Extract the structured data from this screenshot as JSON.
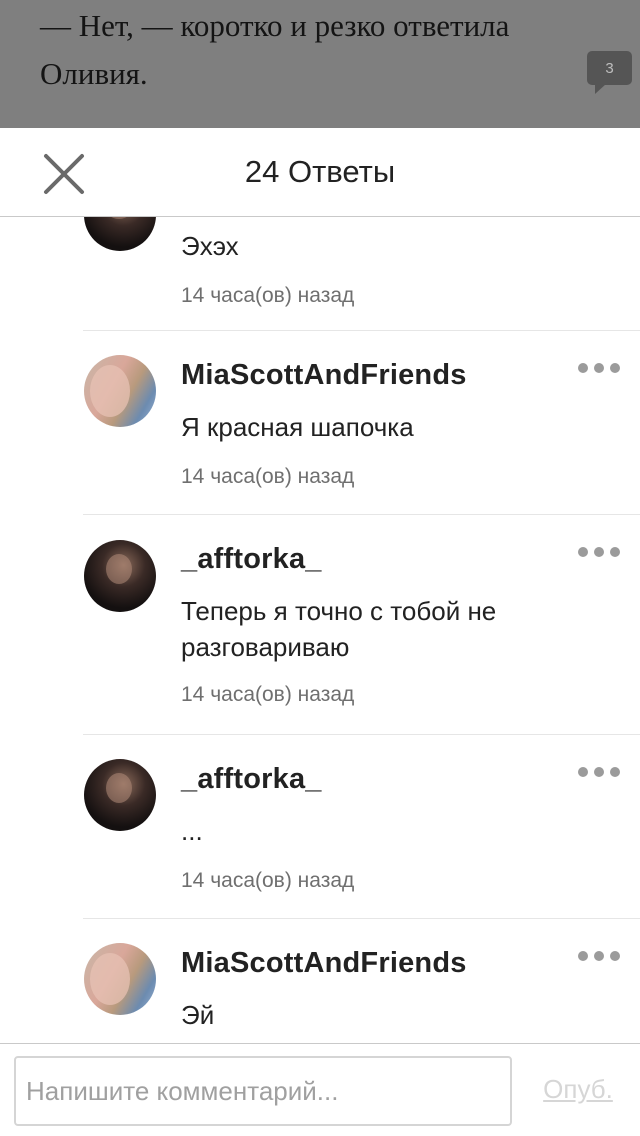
{
  "story": {
    "text": "— Нет, — коротко и резко ответила\nОливия.",
    "comment_count": "3"
  },
  "header": {
    "title": "24 Ответы",
    "close_icon": "close-icon"
  },
  "replies": [
    {
      "author": "",
      "avatar": "dark",
      "text": "Эхэх",
      "time": "14 часа(ов) назад"
    },
    {
      "author": "MiaScottAndFriends",
      "avatar": "light",
      "text": "Я красная шапочка",
      "time": "14 часа(ов) назад"
    },
    {
      "author": "_afftorka_",
      "avatar": "dark",
      "text": "Теперь я точно с тобой не разговариваю",
      "time": "14 часа(ов) назад"
    },
    {
      "author": "_afftorka_",
      "avatar": "dark",
      "text": "...",
      "time": "14 часа(ов) назад"
    },
    {
      "author": "MiaScottAndFriends",
      "avatar": "light",
      "text": "Эй",
      "time": ""
    }
  ],
  "composer": {
    "placeholder": "Напишите комментарий...",
    "value": "",
    "publish_label": "Опуб."
  },
  "colors": {
    "overlay": "#7f7f7f",
    "text": "#222222",
    "muted": "#6f6f6f",
    "publish_disabled": "#d6d6d6"
  }
}
